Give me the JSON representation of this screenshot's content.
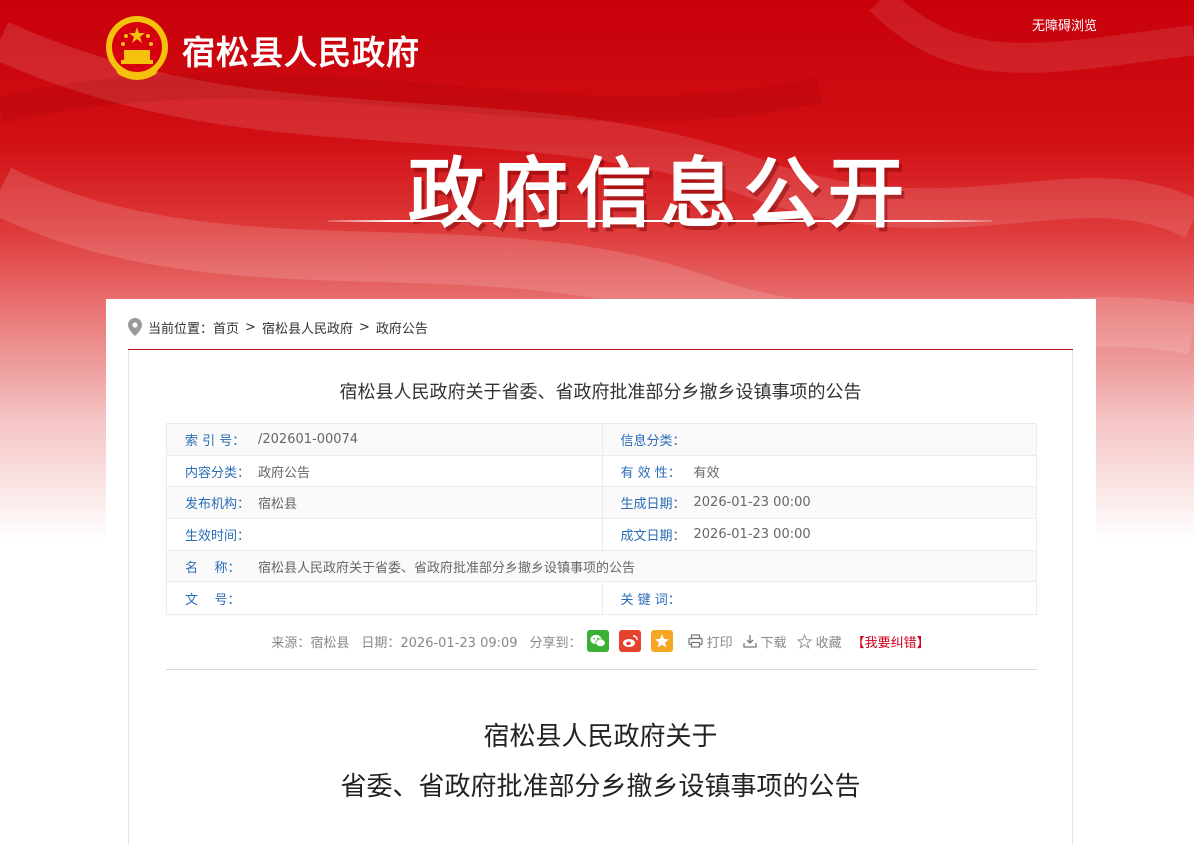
{
  "header": {
    "site_name": "宿松县人民政府",
    "accessibility_link": "无障碍浏览",
    "hero_title": "政府信息公开",
    "brand_red": "#c8000a"
  },
  "breadcrumb": {
    "prefix": "当前位置：",
    "items": [
      "首页",
      "宿松县人民政府",
      "政府公告"
    ],
    "separator": ">"
  },
  "article": {
    "title": "宿松县人民政府关于省委、省政府批准部分乡撤乡设镇事项的公告",
    "meta": {
      "index_no": {
        "label": "索 引 号：",
        "value": "/202601-00074"
      },
      "info_category": {
        "label": "信息分类：",
        "value": ""
      },
      "content_category": {
        "label": "内容分类：",
        "value": "政府公告"
      },
      "validity": {
        "label": "有 效 性：",
        "value": "有效"
      },
      "publisher": {
        "label": "发布机构：",
        "value": "宿松县"
      },
      "created_date": {
        "label": "生成日期：",
        "value": "2026-01-23 00:00"
      },
      "effective_time": {
        "label": "生效时间：",
        "value": ""
      },
      "written_date": {
        "label": "成文日期：",
        "value": "2026-01-23 00:00"
      },
      "name": {
        "label": "名    称：",
        "value": "宿松县人民政府关于省委、省政府批准部分乡撤乡设镇事项的公告"
      },
      "doc_no": {
        "label": "文    号：",
        "value": ""
      },
      "keywords": {
        "label": "关 键 词：",
        "value": ""
      }
    },
    "share_bar": {
      "source": "来源：宿松县",
      "date": "日期：2026-01-23 09:09",
      "share_label": "分享到：",
      "share_icons": [
        "wechat-icon",
        "weibo-icon",
        "qzone-star-icon"
      ],
      "print": "打印",
      "download": "下载",
      "favorite": "收藏",
      "report": "【我要纠错】",
      "colors": {
        "wechat": "#3cb034",
        "weibo": "#e6432e",
        "qzone": "#f5a623",
        "report": "#d0021b"
      }
    },
    "heading_line1": "宿松县人民政府关于",
    "heading_line2": "省委、省政府批准部分乡撤乡设镇事项的公告"
  }
}
